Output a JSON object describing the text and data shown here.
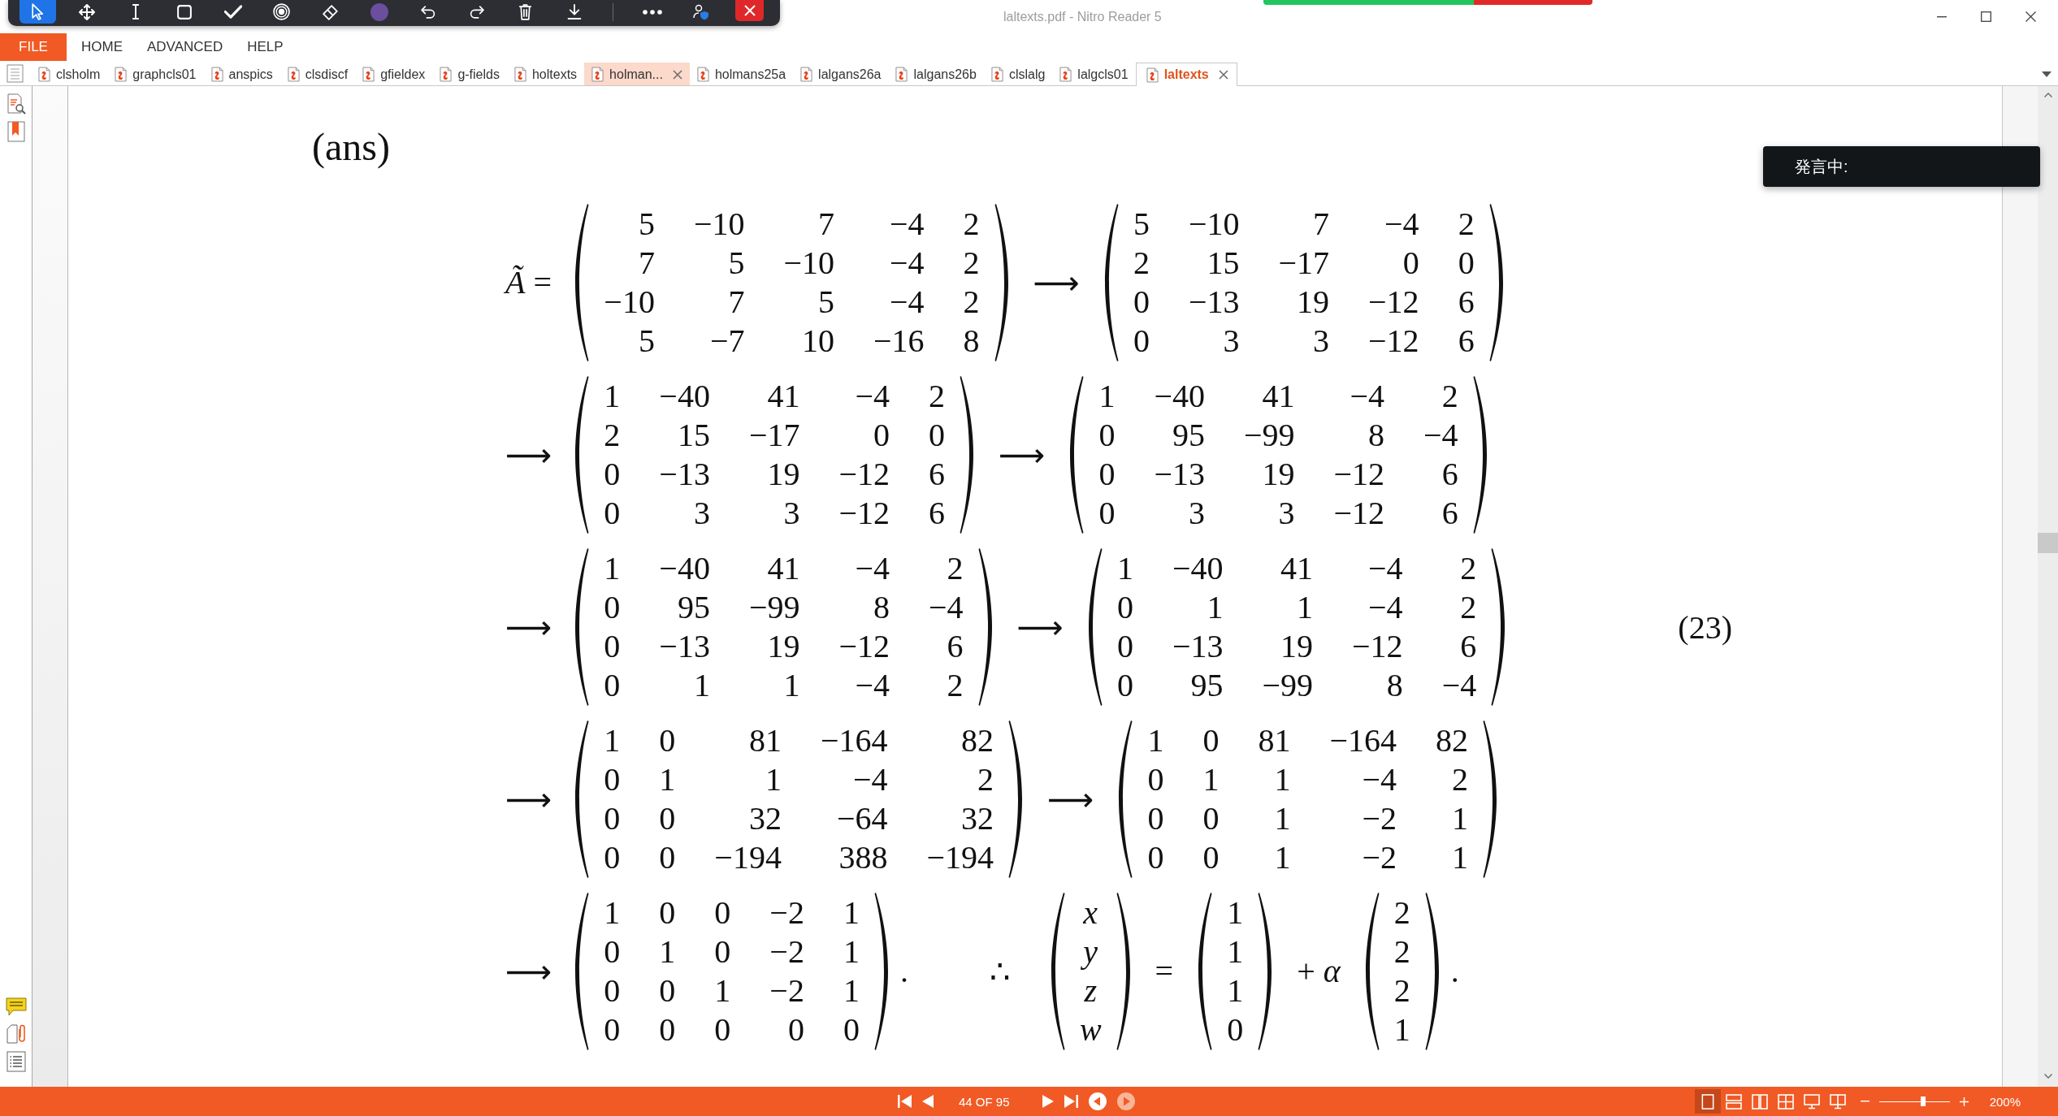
{
  "floating_toolbar": {
    "tools": [
      {
        "kind": "pointer",
        "selected": true
      },
      {
        "kind": "move",
        "selected": false
      },
      {
        "kind": "text",
        "selected": false
      },
      {
        "kind": "rectangle",
        "selected": false
      },
      {
        "kind": "check",
        "selected": false
      },
      {
        "kind": "record",
        "selected": false
      },
      {
        "kind": "eraser",
        "selected": false
      },
      {
        "kind": "color",
        "selected": false,
        "color": "#6b4e9e"
      },
      {
        "kind": "undo",
        "selected": false
      },
      {
        "kind": "redo",
        "selected": false
      },
      {
        "kind": "delete",
        "selected": false
      },
      {
        "kind": "download",
        "selected": false
      }
    ],
    "actions": [
      {
        "kind": "more"
      },
      {
        "kind": "user"
      },
      {
        "kind": "close"
      }
    ]
  },
  "window": {
    "title": "laltexts.pdf - Nitro Reader 5"
  },
  "menu": [
    {
      "label": "FILE",
      "kind": "file"
    },
    {
      "label": "HOME",
      "kind": "tab"
    },
    {
      "label": "ADVANCED",
      "kind": "tab"
    },
    {
      "label": "HELP",
      "kind": "tab"
    }
  ],
  "tabs": [
    {
      "label": "clsholm",
      "selected": false,
      "hovered": false
    },
    {
      "label": "graphcls01",
      "selected": false,
      "hovered": false
    },
    {
      "label": "anspics",
      "selected": false,
      "hovered": false
    },
    {
      "label": "clsdiscf",
      "selected": false,
      "hovered": false
    },
    {
      "label": "gfieldex",
      "selected": false,
      "hovered": false
    },
    {
      "label": "g-fields",
      "selected": false,
      "hovered": false
    },
    {
      "label": "holtexts",
      "selected": false,
      "hovered": false
    },
    {
      "label": "holman...",
      "selected": false,
      "hovered": true
    },
    {
      "label": "holmans25a",
      "selected": false,
      "hovered": false
    },
    {
      "label": "lalgans26a",
      "selected": false,
      "hovered": false
    },
    {
      "label": "lalgans26b",
      "selected": false,
      "hovered": false
    },
    {
      "label": "clslalg",
      "selected": false,
      "hovered": false
    },
    {
      "label": "lalgcls01",
      "selected": false,
      "hovered": false
    },
    {
      "label": "laltexts",
      "selected": true,
      "hovered": false
    }
  ],
  "document": {
    "heading": "(ans)",
    "equation": {
      "lines": [
        {
          "lead": {
            "kind": "symbol",
            "text": "*Ã* ="
          },
          "parts": [
            {
              "kind": "matrix",
              "italic": false,
              "rows": [
                [
                  "5",
                  "−10",
                  "7",
                  "−4",
                  "2"
                ],
                [
                  "7",
                  "5",
                  "−10",
                  "−4",
                  "2"
                ],
                [
                  "−10",
                  "7",
                  "5",
                  "−4",
                  "2"
                ],
                [
                  "5",
                  "−7",
                  "10",
                  "−16",
                  "8"
                ]
              ]
            },
            {
              "kind": "arrow",
              "text": "⟶"
            },
            {
              "kind": "matrix",
              "italic": false,
              "rows": [
                [
                  "5",
                  "−10",
                  "7",
                  "−4",
                  "2"
                ],
                [
                  "2",
                  "15",
                  "−17",
                  "0",
                  "0"
                ],
                [
                  "0",
                  "−13",
                  "19",
                  "−12",
                  "6"
                ],
                [
                  "0",
                  "3",
                  "3",
                  "−12",
                  "6"
                ]
              ]
            }
          ]
        },
        {
          "lead": {
            "kind": "arrow",
            "text": "⟶"
          },
          "parts": [
            {
              "kind": "matrix",
              "italic": false,
              "rows": [
                [
                  "1",
                  "−40",
                  "41",
                  "−4",
                  "2"
                ],
                [
                  "2",
                  "15",
                  "−17",
                  "0",
                  "0"
                ],
                [
                  "0",
                  "−13",
                  "19",
                  "−12",
                  "6"
                ],
                [
                  "0",
                  "3",
                  "3",
                  "−12",
                  "6"
                ]
              ]
            },
            {
              "kind": "arrow",
              "text": "⟶"
            },
            {
              "kind": "matrix",
              "italic": false,
              "rows": [
                [
                  "1",
                  "−40",
                  "41",
                  "−4",
                  "2"
                ],
                [
                  "0",
                  "95",
                  "−99",
                  "8",
                  "−4"
                ],
                [
                  "0",
                  "−13",
                  "19",
                  "−12",
                  "6"
                ],
                [
                  "0",
                  "3",
                  "3",
                  "−12",
                  "6"
                ]
              ]
            }
          ]
        },
        {
          "lead": {
            "kind": "arrow",
            "text": "⟶"
          },
          "parts": [
            {
              "kind": "matrix",
              "italic": false,
              "rows": [
                [
                  "1",
                  "−40",
                  "41",
                  "−4",
                  "2"
                ],
                [
                  "0",
                  "95",
                  "−99",
                  "8",
                  "−4"
                ],
                [
                  "0",
                  "−13",
                  "19",
                  "−12",
                  "6"
                ],
                [
                  "0",
                  "1",
                  "1",
                  "−4",
                  "2"
                ]
              ]
            },
            {
              "kind": "arrow",
              "text": "⟶"
            },
            {
              "kind": "matrix",
              "italic": false,
              "rows": [
                [
                  "1",
                  "−40",
                  "41",
                  "−4",
                  "2"
                ],
                [
                  "0",
                  "1",
                  "1",
                  "−4",
                  "2"
                ],
                [
                  "0",
                  "−13",
                  "19",
                  "−12",
                  "6"
                ],
                [
                  "0",
                  "95",
                  "−99",
                  "8",
                  "−4"
                ]
              ]
            }
          ]
        },
        {
          "lead": {
            "kind": "arrow",
            "text": "⟶"
          },
          "parts": [
            {
              "kind": "matrix",
              "italic": false,
              "rows": [
                [
                  "1",
                  "0",
                  "81",
                  "−164",
                  "82"
                ],
                [
                  "0",
                  "1",
                  "1",
                  "−4",
                  "2"
                ],
                [
                  "0",
                  "0",
                  "32",
                  "−64",
                  "32"
                ],
                [
                  "0",
                  "0",
                  "−194",
                  "388",
                  "−194"
                ]
              ]
            },
            {
              "kind": "arrow",
              "text": "⟶"
            },
            {
              "kind": "matrix",
              "italic": false,
              "rows": [
                [
                  "1",
                  "0",
                  "81",
                  "−164",
                  "82"
                ],
                [
                  "0",
                  "1",
                  "1",
                  "−4",
                  "2"
                ],
                [
                  "0",
                  "0",
                  "1",
                  "−2",
                  "1"
                ],
                [
                  "0",
                  "0",
                  "1",
                  "−2",
                  "1"
                ]
              ]
            }
          ]
        },
        {
          "lead": {
            "kind": "arrow",
            "text": "⟶"
          },
          "parts": [
            {
              "kind": "matrix",
              "italic": false,
              "rows": [
                [
                  "1",
                  "0",
                  "0",
                  "−2",
                  "1"
                ],
                [
                  "0",
                  "1",
                  "0",
                  "−2",
                  "1"
                ],
                [
                  "0",
                  "0",
                  "1",
                  "−2",
                  "1"
                ],
                [
                  "0",
                  "0",
                  "0",
                  "0",
                  "0"
                ]
              ]
            },
            {
              "kind": "period",
              "text": "."
            },
            {
              "kind": "spaced",
              "text": "∴"
            },
            {
              "kind": "matrix",
              "italic": true,
              "rows": [
                [
                  "x"
                ],
                [
                  "y"
                ],
                [
                  "z"
                ],
                [
                  "w"
                ]
              ]
            },
            {
              "kind": "symbol",
              "text": "="
            },
            {
              "kind": "matrix",
              "italic": false,
              "rows": [
                [
                  "1"
                ],
                [
                  "1"
                ],
                [
                  "1"
                ],
                [
                  "0"
                ]
              ]
            },
            {
              "kind": "symbol",
              "text": "+ *α*"
            },
            {
              "kind": "matrix",
              "italic": false,
              "rows": [
                [
                  "2"
                ],
                [
                  "2"
                ],
                [
                  "2"
                ],
                [
                  "1"
                ]
              ]
            },
            {
              "kind": "period",
              "text": "."
            }
          ]
        }
      ],
      "number": "(23)"
    }
  },
  "overlay": {
    "text": "発言中:"
  },
  "status_bar": {
    "nav_left": [
      {
        "kind": "first",
        "disabled": false
      },
      {
        "kind": "previous",
        "disabled": false
      }
    ],
    "page": "44 OF 95",
    "nav_right": [
      {
        "kind": "next",
        "disabled": false
      },
      {
        "kind": "last",
        "disabled": false
      },
      {
        "kind": "back",
        "disabled": false
      },
      {
        "kind": "forward",
        "disabled": true
      }
    ],
    "view_modes": [
      {
        "kind": "single",
        "selected": true
      },
      {
        "kind": "continuous",
        "selected": false
      },
      {
        "kind": "facing",
        "selected": false
      },
      {
        "kind": "facing-continuous",
        "selected": false
      },
      {
        "kind": "cover",
        "selected": false
      },
      {
        "kind": "cover-continuous",
        "selected": false
      }
    ],
    "zoom": {
      "level": 0.62,
      "reading": "200%"
    }
  }
}
